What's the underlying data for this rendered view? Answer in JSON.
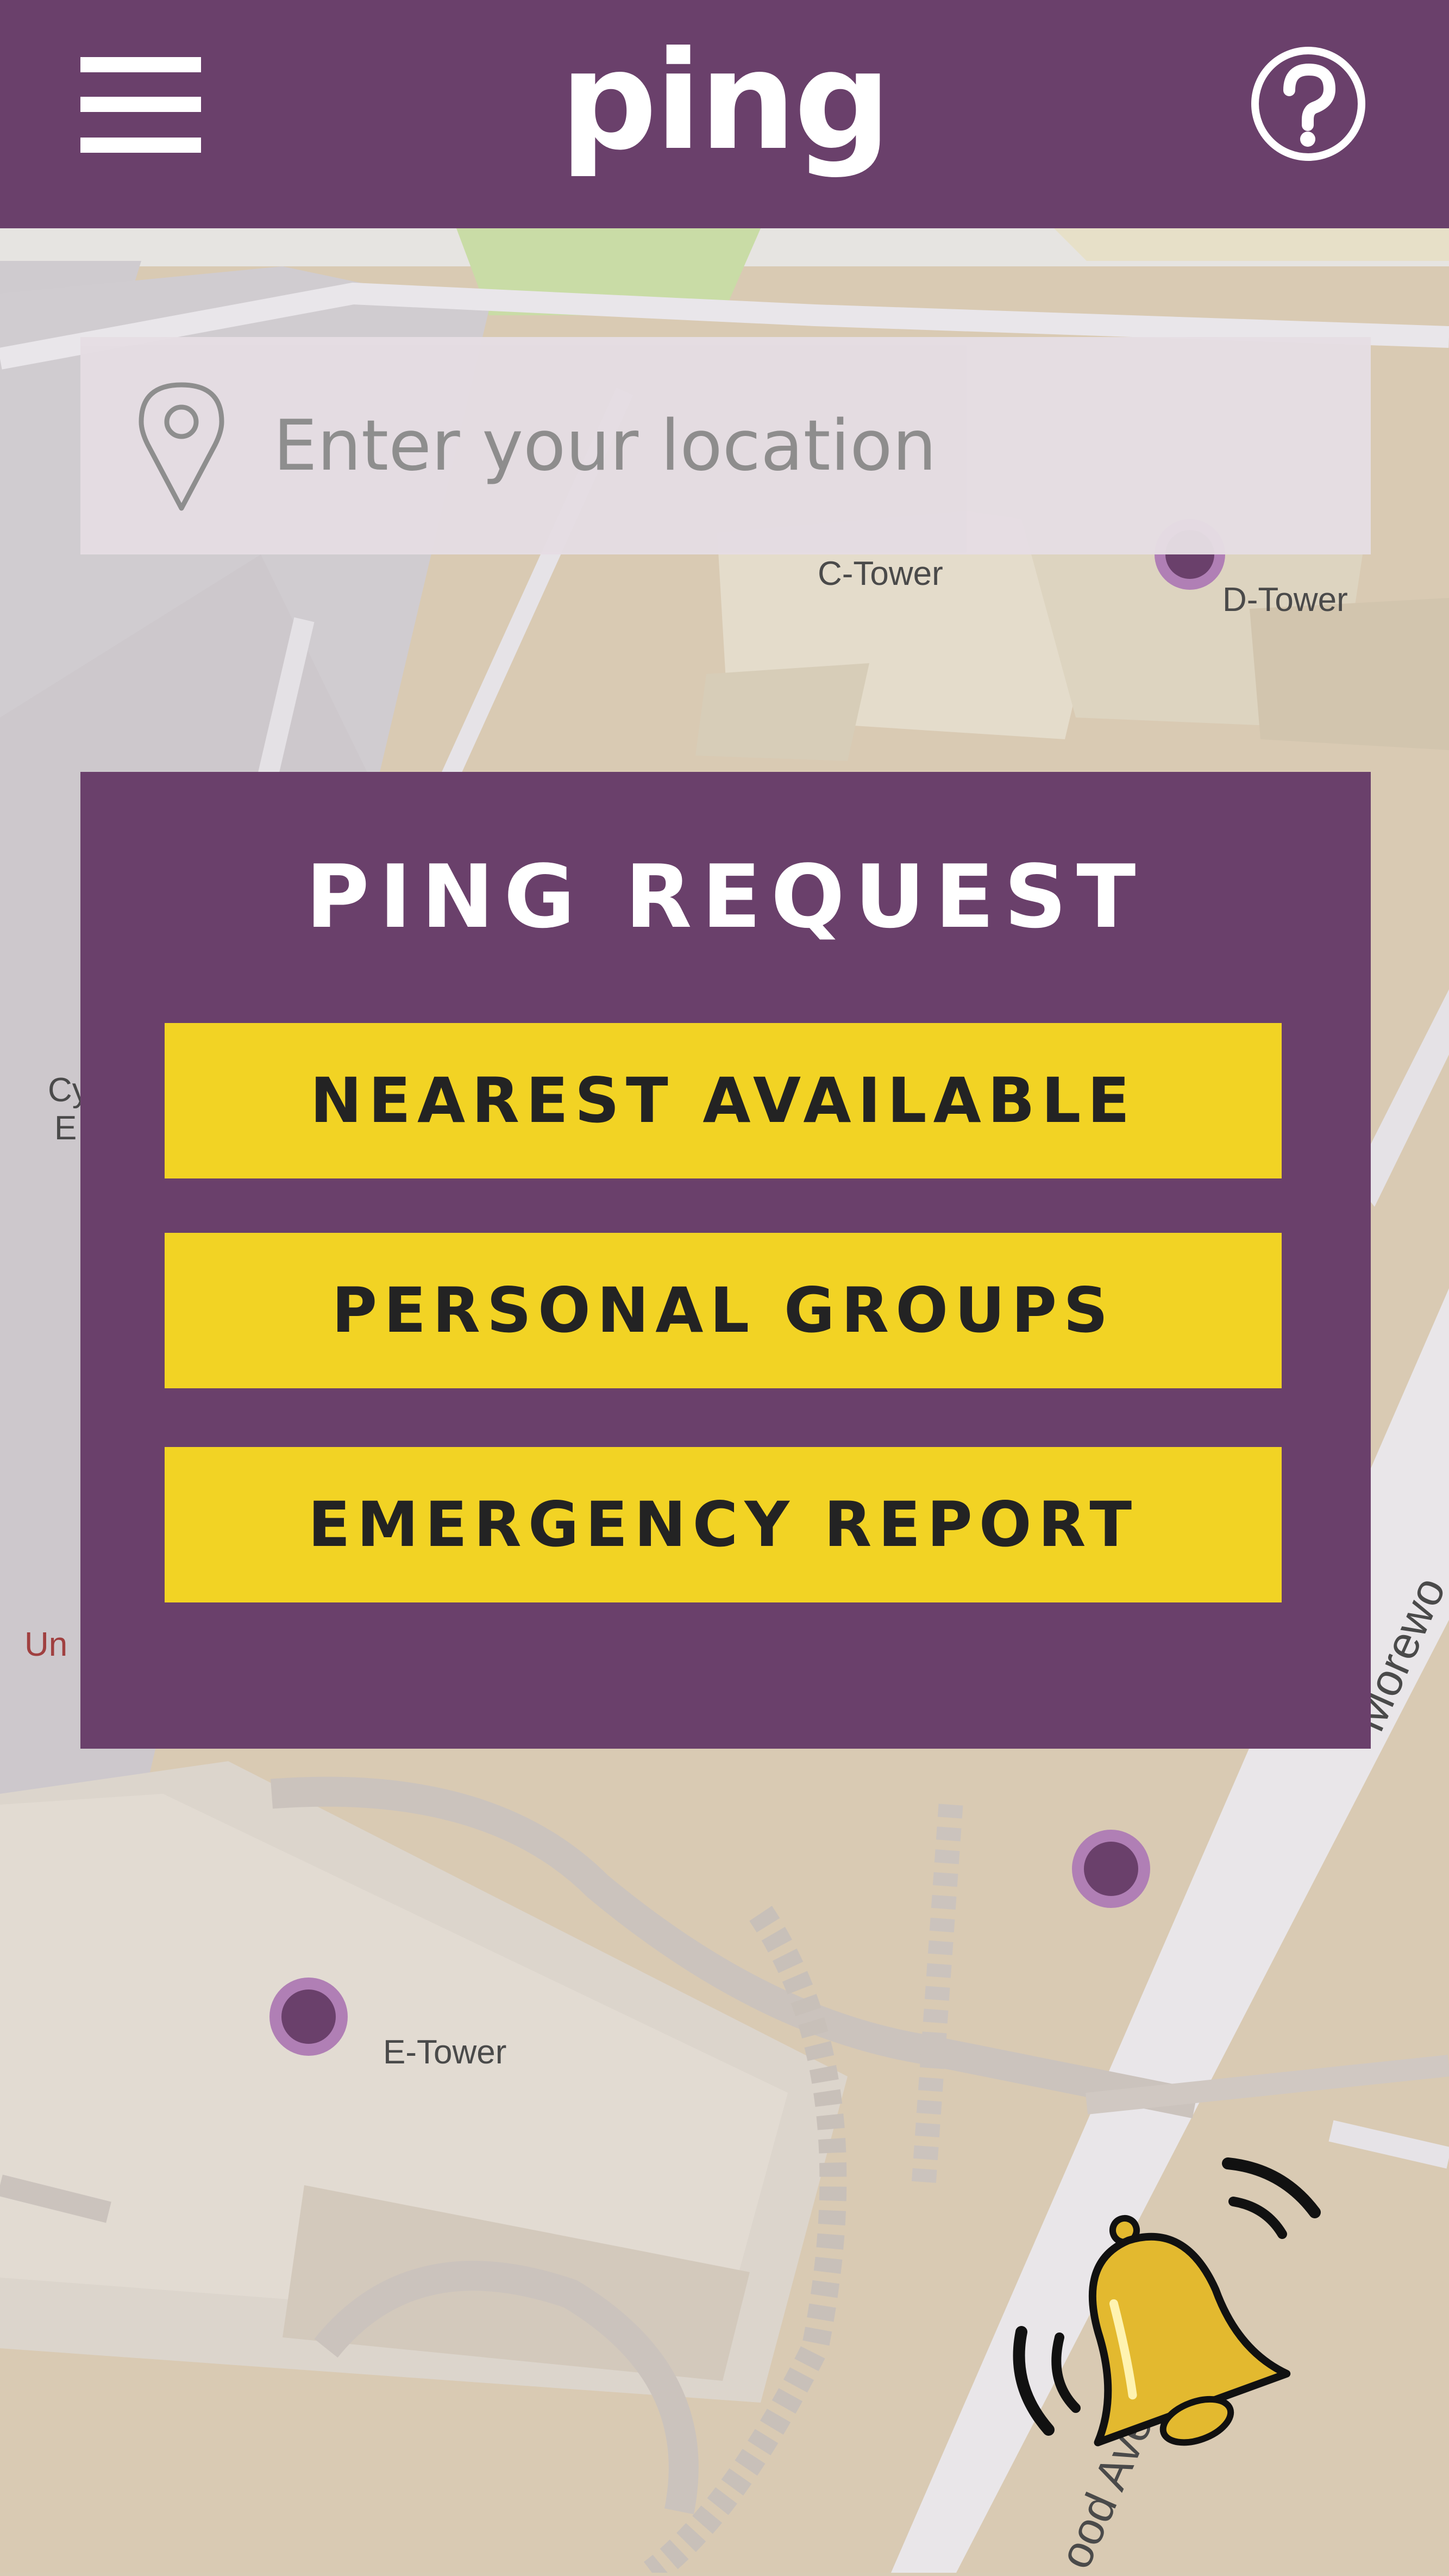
{
  "header": {
    "app_title": "ping"
  },
  "search": {
    "placeholder": "Enter your location"
  },
  "map": {
    "labels": {
      "c_tower": "C-Tower",
      "d_tower": "D-Tower",
      "e_tower": "E-Tower",
      "street": "Morewo",
      "street_bottom": "ood Ave",
      "partial_left_1": "Cy",
      "partial_left_2": "E",
      "partial_left_red": "Un"
    }
  },
  "ping_request": {
    "title": "PING REQUEST",
    "buttons": {
      "nearest": "NEAREST AVAILABLE",
      "groups": "PERSONAL GROUPS",
      "emergency": "EMERGENCY REPORT"
    }
  },
  "colors": {
    "primary": "#6a406b",
    "accent": "#f2d324",
    "map_marker": "#6a406b",
    "map_marker_ring": "#b07fb5"
  }
}
